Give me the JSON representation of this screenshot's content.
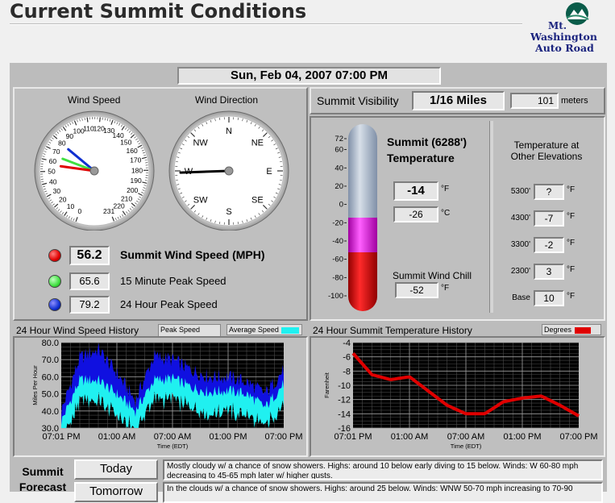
{
  "page": {
    "title": "Current Summit Conditions",
    "logo": {
      "line1": "Mt.",
      "line2": "Washington",
      "line3": "Auto Road"
    }
  },
  "datetime": "Sun, Feb 04, 2007   07:00 PM",
  "wind": {
    "speed_gauge_label": "Wind Speed",
    "direction_gauge_label": "Wind Direction",
    "speed_ticks": [
      "0",
      "10",
      "20",
      "30",
      "40",
      "50",
      "60",
      "70",
      "80",
      "90",
      "100",
      "110",
      "120",
      "130",
      "140",
      "150",
      "160",
      "170",
      "180",
      "190",
      "200",
      "210",
      "220",
      "231"
    ],
    "compass": [
      "N",
      "NE",
      "E",
      "SE",
      "S",
      "SW",
      "W",
      "NW"
    ],
    "summit_speed": "56.2",
    "summit_speed_label": "Summit Wind Speed (MPH)",
    "peak15": "65.6",
    "peak15_label": "15 Minute Peak Speed",
    "peak24": "79.2",
    "peak24_label": "24 Hour Peak Speed",
    "direction_deg": 268,
    "colors": {
      "summit": "#e00000",
      "peak15": "#40e040",
      "peak24": "#1030d0"
    }
  },
  "visibility": {
    "label": "Summit Visibility",
    "miles": "1/16 Miles",
    "meters": "101",
    "meters_unit": "meters"
  },
  "temperature": {
    "title_line1": "Summit (6288')",
    "title_line2": "Temperature",
    "scale": [
      "72",
      "60",
      "40",
      "20",
      "0",
      "-20",
      "-40",
      "-60",
      "-80",
      "-100"
    ],
    "fahrenheit": "-14",
    "celsius": "-26",
    "unit_f": "°F",
    "unit_c": "°C",
    "wind_chill_label": "Summit Wind Chill",
    "wind_chill": "-52",
    "elevations_title": "Temperature at Other Elevations",
    "elevations": [
      {
        "label": "5300'",
        "value": "?"
      },
      {
        "label": "4300'",
        "value": "-7"
      },
      {
        "label": "3300'",
        "value": "-2"
      },
      {
        "label": "2300'",
        "value": "3"
      },
      {
        "label": "Base",
        "value": "10"
      }
    ]
  },
  "wind_history": {
    "title": "24 Hour Wind Speed History",
    "legend_peak": "Peak Speed",
    "legend_avg": "Average Speed",
    "ylabel": "Miles Per Hour",
    "xlabel": "Time (EDT)",
    "y_ticks": [
      "80.0",
      "70.0",
      "60.0",
      "50.0",
      "40.0",
      "30.0"
    ],
    "x_ticks": [
      "07:01 PM",
      "01:00 AM",
      "07:00 AM",
      "01:00 PM",
      "07:00 PM"
    ]
  },
  "temp_history": {
    "title": "24 Hour Summit Temperature History",
    "legend": "Degrees",
    "ylabel": "Farenheit",
    "xlabel": "Time (EDT)",
    "y_ticks": [
      "-4",
      "-6",
      "-8",
      "-10",
      "-12",
      "-14",
      "-16"
    ],
    "x_ticks": [
      "07:01 PM",
      "01:00 AM",
      "07:00 AM",
      "01:00 PM",
      "07:00 PM"
    ]
  },
  "chart_data": [
    {
      "type": "area",
      "title": "24 Hour Wind Speed History",
      "xlabel": "Time (EDT)",
      "ylabel": "Miles Per Hour",
      "ylim": [
        30,
        80
      ],
      "x": [
        "07:01 PM",
        "09:00 PM",
        "11:00 PM",
        "01:00 AM",
        "03:00 AM",
        "05:00 AM",
        "07:00 AM",
        "09:00 AM",
        "11:00 AM",
        "01:00 PM",
        "03:00 PM",
        "05:00 PM",
        "07:00 PM"
      ],
      "series": [
        {
          "name": "Peak Speed",
          "values": [
            40,
            71,
            76,
            62,
            46,
            72,
            70,
            64,
            60,
            60,
            57,
            50,
            64
          ]
        },
        {
          "name": "Average Speed",
          "values": [
            34,
            58,
            58,
            50,
            40,
            58,
            59,
            54,
            51,
            52,
            50,
            42,
            56
          ]
        }
      ],
      "colors": {
        "Peak Speed": "#1010e0",
        "Average Speed": "#20f0f0"
      },
      "grid": true
    },
    {
      "type": "line",
      "title": "24 Hour Summit Temperature History",
      "xlabel": "Time (EDT)",
      "ylabel": "Farenheit",
      "ylim": [
        -16,
        -4
      ],
      "x": [
        "07:01 PM",
        "09:00 PM",
        "11:00 PM",
        "01:00 AM",
        "03:00 AM",
        "05:00 AM",
        "07:00 AM",
        "09:00 AM",
        "11:00 AM",
        "01:00 PM",
        "03:00 PM",
        "05:00 PM",
        "07:00 PM"
      ],
      "series": [
        {
          "name": "Degrees",
          "values": [
            -5.5,
            -8.5,
            -9.2,
            -8.8,
            -10.8,
            -12.8,
            -14.0,
            -14.0,
            -12.3,
            -11.8,
            -11.5,
            -12.8,
            -14.3
          ]
        }
      ],
      "colors": {
        "Degrees": "#e00000"
      },
      "grid": true
    }
  ],
  "forecast": {
    "label_line1": "Summit",
    "label_line2": "Forecast",
    "today_label": "Today",
    "today_text": "Mostly cloudy w/ a chance of snow showers.  Highs: around 10 below early diving to 15 below.  Winds: W 60-80 mph decreasing to 45-65 mph later w/ higher gusts.",
    "tomorrow_label": "Tomorrow",
    "tomorrow_text": "In the clouds w/ a chance of snow showers.  Highs: around 25 below.  Winds: WNW 50-70 mph increasing to 70-90"
  }
}
